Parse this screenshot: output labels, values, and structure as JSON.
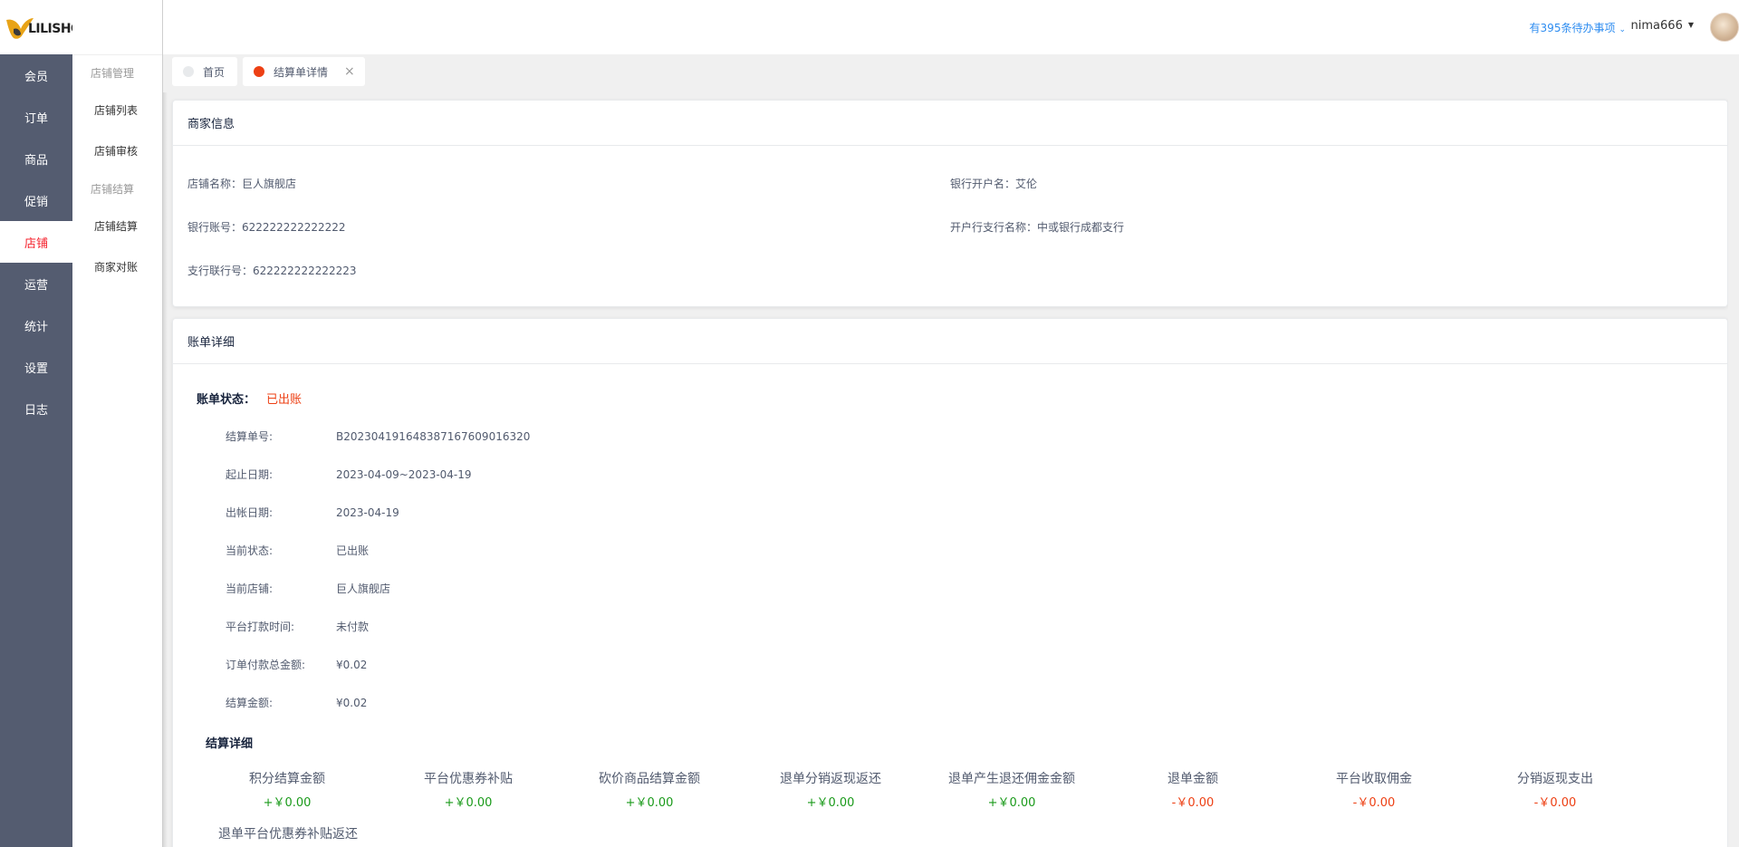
{
  "logo": {
    "text": "LILISHOP"
  },
  "main_nav": [
    {
      "label": "会员"
    },
    {
      "label": "订单"
    },
    {
      "label": "商品"
    },
    {
      "label": "促销"
    },
    {
      "label": "店铺",
      "active": true
    },
    {
      "label": "运营"
    },
    {
      "label": "统计"
    },
    {
      "label": "设置"
    },
    {
      "label": "日志"
    }
  ],
  "sub_nav": {
    "group1": "店铺管理",
    "item1": "店铺列表",
    "item2": "店铺审核",
    "group2": "店铺结算",
    "item3": "店铺结算",
    "item4": "商家对账"
  },
  "header": {
    "todo": "有395条待办事项",
    "username": "nima666"
  },
  "tabs": [
    {
      "label": "首页"
    },
    {
      "label": "结算单详情"
    }
  ],
  "merchant": {
    "title": "商家信息",
    "store_name": "店铺名称：巨人旗舰店",
    "bank_account_name": "银行开户名：艾伦",
    "bank_account_no": "银行账号：622222222222222",
    "bank_branch_name": "开户行支行名称：中或银行成都支行",
    "branch_code": "支行联行号：622222222222223"
  },
  "bill": {
    "title": "账单详细",
    "status_label": "账单状态：",
    "status_value": "已出账",
    "rows": [
      {
        "label": "结算单号:",
        "value": "B202304191648387167609016320"
      },
      {
        "label": "起止日期:",
        "value": "2023-04-09~2023-04-19"
      },
      {
        "label": "出帐日期:",
        "value": "2023-04-19"
      },
      {
        "label": "当前状态:",
        "value": "已出账"
      },
      {
        "label": "当前店铺:",
        "value": "巨人旗舰店"
      },
      {
        "label": "平台打款时间:",
        "value": "未付款"
      },
      {
        "label": "订单付款总金额:",
        "value": "¥0.02"
      },
      {
        "label": "结算金额:",
        "value": "¥0.02"
      }
    ],
    "settle_title": "结算详细",
    "settle_items": [
      {
        "label": "积分结算金额",
        "value": "+￥0.00",
        "color": "#1a9a1a"
      },
      {
        "label": "平台优惠券补贴",
        "value": "+￥0.00",
        "color": "#1a9a1a"
      },
      {
        "label": "砍价商品结算金额",
        "value": "+￥0.00",
        "color": "#1a9a1a"
      },
      {
        "label": "退单分销返现返还",
        "value": "+￥0.00",
        "color": "#1a9a1a"
      },
      {
        "label": "退单产生退还佣金金额",
        "value": "+￥0.00",
        "color": "#1a9a1a"
      },
      {
        "label": "退单金额",
        "value": "-￥0.00",
        "color": "#ed4014"
      },
      {
        "label": "平台收取佣金",
        "value": "-￥0.00",
        "color": "#ed4014"
      },
      {
        "label": "分销返现支出",
        "value": "-￥0.00",
        "color": "#ed4014"
      }
    ],
    "cut_label": "退单平台优惠券补贴返还"
  }
}
